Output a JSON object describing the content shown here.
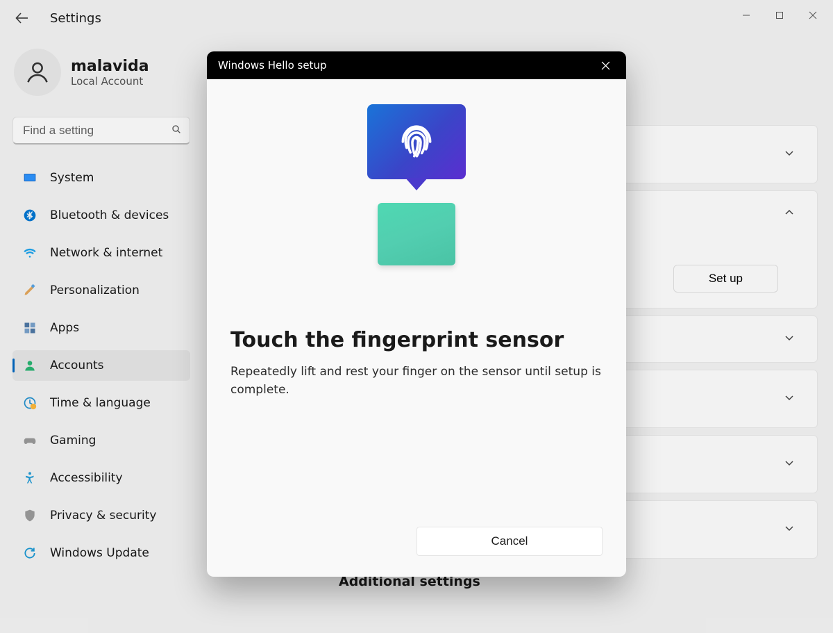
{
  "window": {
    "app_title": "Settings"
  },
  "user": {
    "name": "malavida",
    "subtitle": "Local Account"
  },
  "search": {
    "placeholder": "Find a setting"
  },
  "nav": {
    "system": "System",
    "bluetooth": "Bluetooth & devices",
    "network": "Network & internet",
    "personalization": "Personalization",
    "apps": "Apps",
    "accounts": "Accounts",
    "time": "Time & language",
    "gaming": "Gaming",
    "accessibility": "Accessibility",
    "privacy": "Privacy & security",
    "update": "Windows Update"
  },
  "content": {
    "setup_label": "Set up",
    "additional": "Additional settings"
  },
  "modal": {
    "header": "Windows Hello setup",
    "title": "Touch the fingerprint sensor",
    "body": "Repeatedly lift and rest your finger on the sensor until setup is complete.",
    "cancel": "Cancel"
  }
}
